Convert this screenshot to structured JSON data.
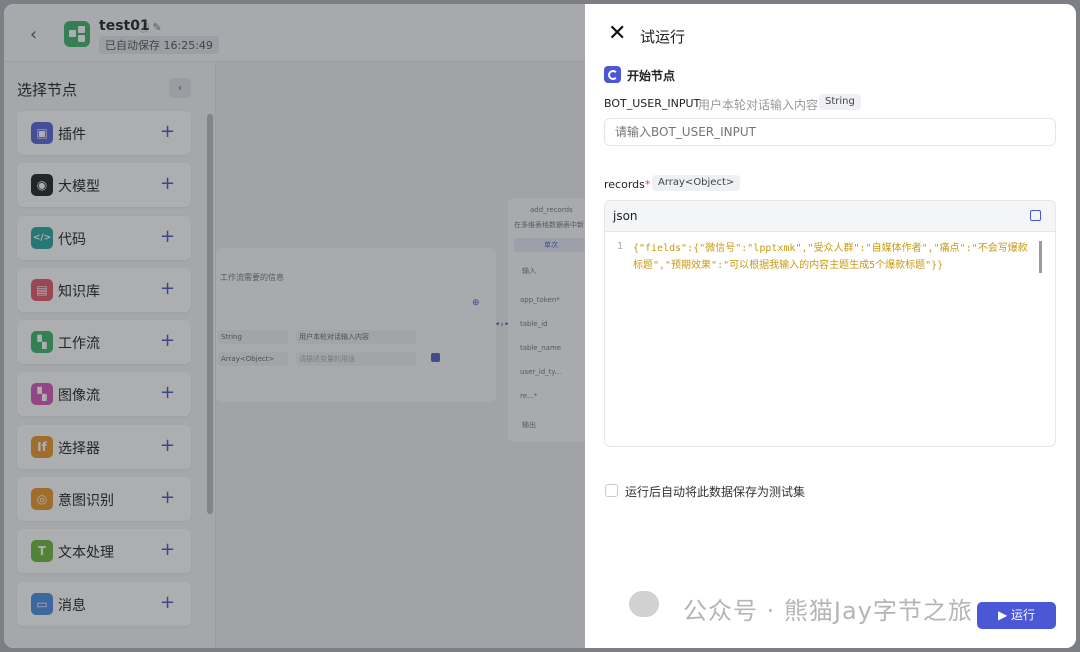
{
  "app": {
    "title": "test01",
    "saved": "已自动保存 16:25:49"
  },
  "sidebar": {
    "title": "选择节点",
    "items": [
      {
        "label": "插件",
        "icon": "plugin-icon",
        "color": "#5b64d8"
      },
      {
        "label": "大模型",
        "icon": "llm-icon",
        "color": "#222222"
      },
      {
        "label": "代码",
        "icon": "code-icon",
        "color": "#2aa7a0"
      },
      {
        "label": "知识库",
        "icon": "knowledge-icon",
        "color": "#e25a6a"
      },
      {
        "label": "工作流",
        "icon": "workflow-icon",
        "color": "#3cb46a"
      },
      {
        "label": "图像流",
        "icon": "imageflow-icon",
        "color": "#d45ab8"
      },
      {
        "label": "选择器",
        "icon": "selector-icon",
        "color": "#e8962a"
      },
      {
        "label": "意图识别",
        "icon": "intent-icon",
        "color": "#e8962a"
      },
      {
        "label": "文本处理",
        "icon": "text-process-icon",
        "color": "#6cb83a"
      },
      {
        "label": "消息",
        "icon": "message-icon",
        "color": "#4b8ee0"
      }
    ]
  },
  "canvas": {
    "card1_hint": "工作流需要的信息",
    "row1_type": "String",
    "row1_desc": "用户本轮对话输入内容",
    "row2_type": "Array<Object>",
    "row2_desc": "请描述变量的用途",
    "card2_title": "add_records",
    "card2_sub": "在多维表格数据表中新",
    "card2_tab": "单次",
    "card2_input": "输入",
    "card2_params": [
      "app_token*",
      "table_id",
      "table_name",
      "user_id_ty...",
      "re...*"
    ],
    "card2_output": "输出"
  },
  "panel": {
    "title": "试运行",
    "start_node": "开始节点",
    "bot_input": {
      "name": "BOT_USER_INPUT",
      "desc": "用户本轮对话输入内容",
      "type": "String",
      "placeholder": "请输入BOT_USER_INPUT"
    },
    "records": {
      "name": "records",
      "type": "Array<Object>",
      "lang": "json",
      "line": "1",
      "code": "{\"fields\":{\"微信号\":\"lpptxmk\",\"受众人群\":\"自媒体作者\",\"痛点\":\"不会写爆款标题\",\"预期效果\":\"可以根据我输入的内容主题生成5个爆款标题\"}}"
    },
    "save_checkbox": "运行后自动将此数据保存为测试集",
    "run": "运行",
    "watermark": "公众号 · 熊猫Jay字节之旅"
  }
}
